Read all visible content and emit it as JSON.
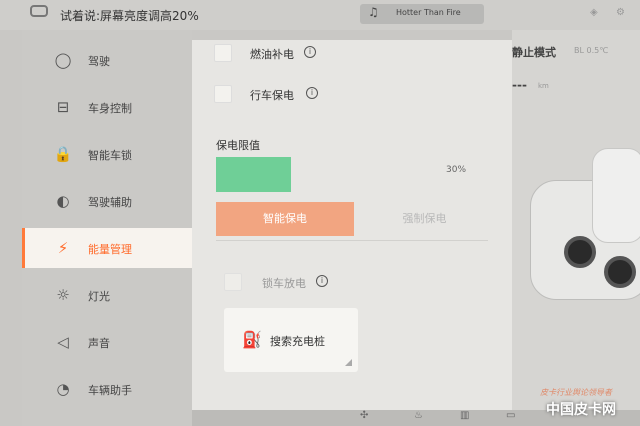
{
  "status_bar": {
    "voice_hint": "试着说:屏幕亮度调高20%",
    "media_title": "Hotter Than Fire",
    "icons": [
      "voice-icon",
      "music-icon",
      "signal-icon",
      "settings-icon"
    ]
  },
  "sidebar": {
    "items": [
      {
        "label": "驾驶",
        "icon": "steering-wheel-icon",
        "glyph": "◯"
      },
      {
        "label": "车身控制",
        "icon": "car-body-icon",
        "glyph": "⊟"
      },
      {
        "label": "智能车锁",
        "icon": "lock-icon",
        "glyph": "🔒"
      },
      {
        "label": "驾驶辅助",
        "icon": "driver-assist-icon",
        "glyph": "◐"
      },
      {
        "label": "能量管理",
        "icon": "energy-icon",
        "glyph": "⚡",
        "active": true
      },
      {
        "label": "灯光",
        "icon": "light-icon",
        "glyph": "☼"
      },
      {
        "label": "声音",
        "icon": "speaker-icon",
        "glyph": "◁"
      },
      {
        "label": "车辆助手",
        "icon": "vehicle-assistant-icon",
        "glyph": "◔"
      }
    ]
  },
  "energy": {
    "fuel_charge_label": "燃油补电",
    "drive_protect_label": "行车保电",
    "protect_limit_title": "保电限值",
    "protect_limit_percent": "30%",
    "protect_limit_fraction": 0.3,
    "smart_protect_button": "智能保电",
    "release_protect_button": "强制保电",
    "lock_discharge_label": "锁车放电",
    "search_pile_label": "搜索充电桩"
  },
  "right_panel": {
    "mode": "静止模式",
    "mode_sub": "BL 0.5℃",
    "range_value": "---",
    "range_unit": "km"
  },
  "bottom_bar": {
    "icons": [
      "fan-icon",
      "seat-heat-icon",
      "defrost-icon",
      "car-icon"
    ]
  },
  "watermark": {
    "line": "皮卡行业舆论领导者",
    "brand": "中国皮卡网"
  },
  "colors": {
    "accent": "#ff6a2a",
    "fill_green": "#6fcf97",
    "button_orange": "#f2a581"
  }
}
